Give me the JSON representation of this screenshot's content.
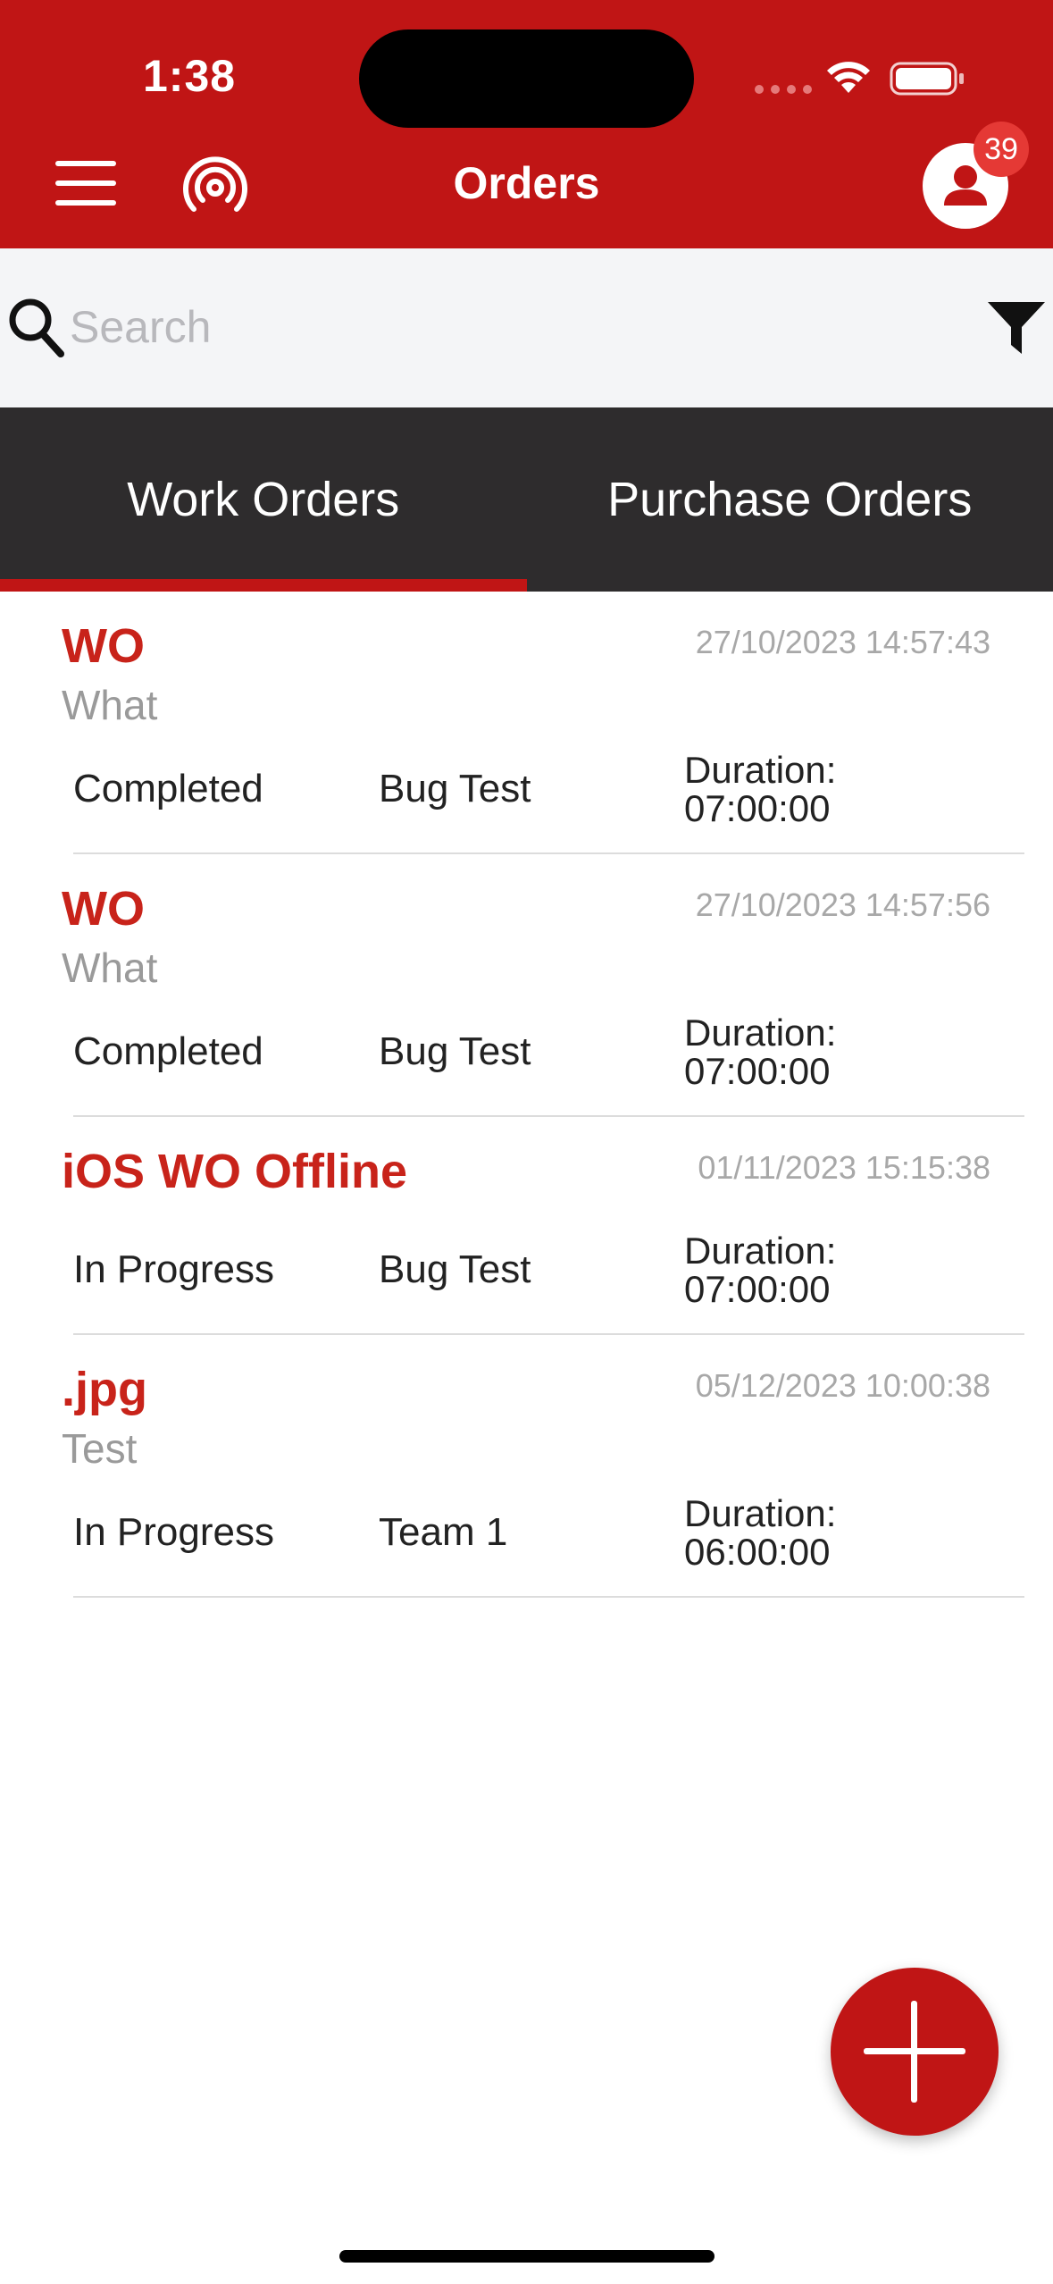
{
  "status_bar": {
    "time": "1:38"
  },
  "header": {
    "title": "Orders",
    "notification_count": "39"
  },
  "search": {
    "placeholder": "Search"
  },
  "tabs": [
    {
      "label": "Work Orders",
      "active": true
    },
    {
      "label": "Purchase Orders",
      "active": false
    }
  ],
  "orders": [
    {
      "title": "WO",
      "subtitle": "What",
      "date": "27/10/2023 14:57:43",
      "status": "Completed",
      "team": "Bug Test",
      "duration_label": "Duration:",
      "duration": "07:00:00"
    },
    {
      "title": "WO",
      "subtitle": "What",
      "date": "27/10/2023 14:57:56",
      "status": "Completed",
      "team": "Bug Test",
      "duration_label": "Duration:",
      "duration": "07:00:00"
    },
    {
      "title": "iOS WO Offline",
      "subtitle": "",
      "date": "01/11/2023 15:15:38",
      "status": "In Progress",
      "team": "Bug Test",
      "duration_label": "Duration:",
      "duration": "07:00:00"
    },
    {
      "title": ".jpg",
      "subtitle": "Test",
      "date": "05/12/2023 10:00:38",
      "status": "In Progress",
      "team": "Team 1",
      "duration_label": "Duration:",
      "duration": "06:00:00"
    }
  ],
  "colors": {
    "brand": "#c01515",
    "tab_bar": "#2e2c2d",
    "title_red": "#c8231a"
  },
  "icons": [
    "menu-icon",
    "broadcast-icon",
    "profile-icon",
    "search-icon",
    "filter-icon",
    "plus-icon",
    "wifi-icon",
    "battery-icon"
  ]
}
